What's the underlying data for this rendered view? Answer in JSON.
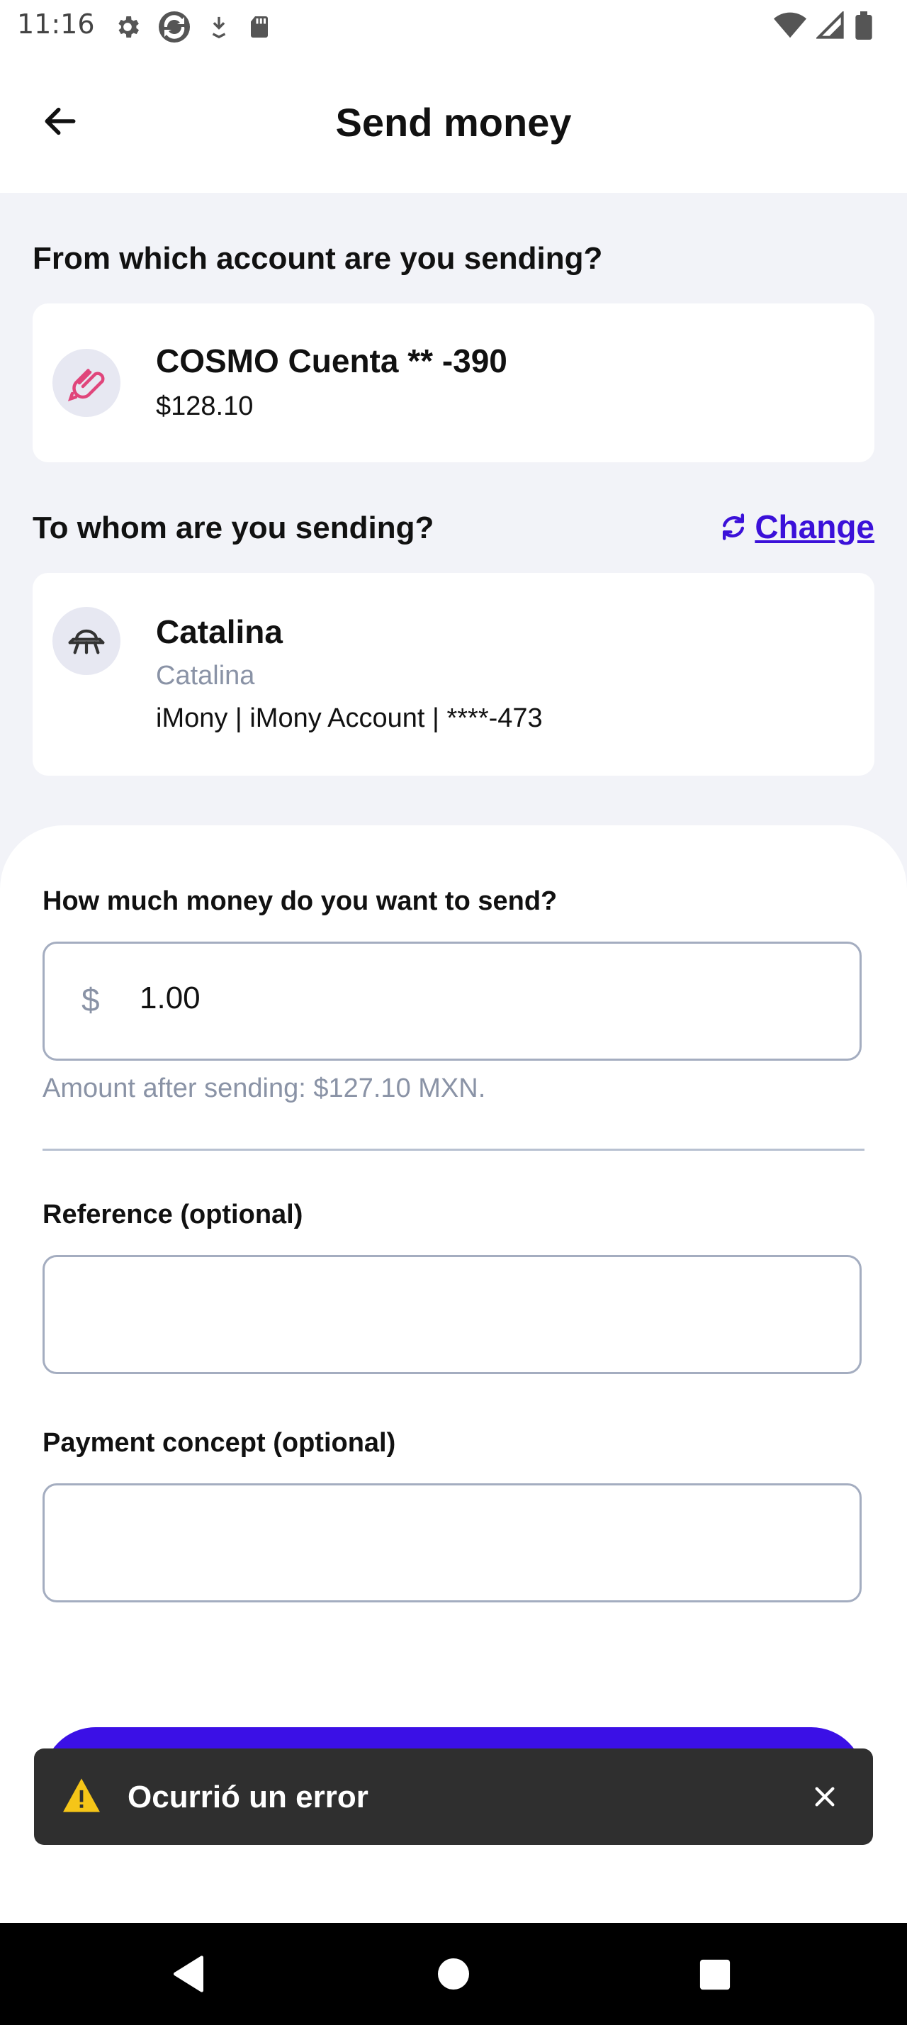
{
  "status_bar": {
    "time": "11:16",
    "left_icons": [
      "settings-icon",
      "sync-icon",
      "download-icon",
      "sd-card-icon"
    ],
    "right_icons": [
      "wifi-icon",
      "signal-icon",
      "battery-icon"
    ]
  },
  "header": {
    "title": "Send money",
    "back_icon": "arrow-left-icon"
  },
  "from_section": {
    "title": "From which account are you sending?",
    "account": {
      "icon": "link-icon",
      "name": "COSMO Cuenta ** -390",
      "balance": "$128.10"
    }
  },
  "to_section": {
    "title": "To whom are you sending?",
    "change_label": "Change",
    "change_icon": "refresh-icon",
    "recipient": {
      "icon": "ufo-icon",
      "name": "Catalina",
      "alias": "Catalina",
      "details": "iMony | iMony Account | ****-473"
    }
  },
  "form": {
    "amount_label": "How much money do you want to send?",
    "currency_symbol": "$",
    "amount_value": "1.00",
    "helper_text": "Amount after sending: $127.10 MXN.",
    "reference_label": "Reference (optional)",
    "reference_value": "",
    "concept_label": "Payment concept (optional)",
    "concept_value": ""
  },
  "snackbar": {
    "icon": "warning-icon",
    "message": "Ocurrió un error",
    "close_icon": "close-icon"
  },
  "nav_bar": {
    "icons": [
      "back-triangle-icon",
      "home-circle-icon",
      "recents-square-icon"
    ]
  },
  "colors": {
    "primary": "#3b10e6",
    "page_background": "#f2f3f8",
    "link": "#3b10d9",
    "warning": "#f5c518",
    "snackbar_bg": "#2f2f2f"
  }
}
